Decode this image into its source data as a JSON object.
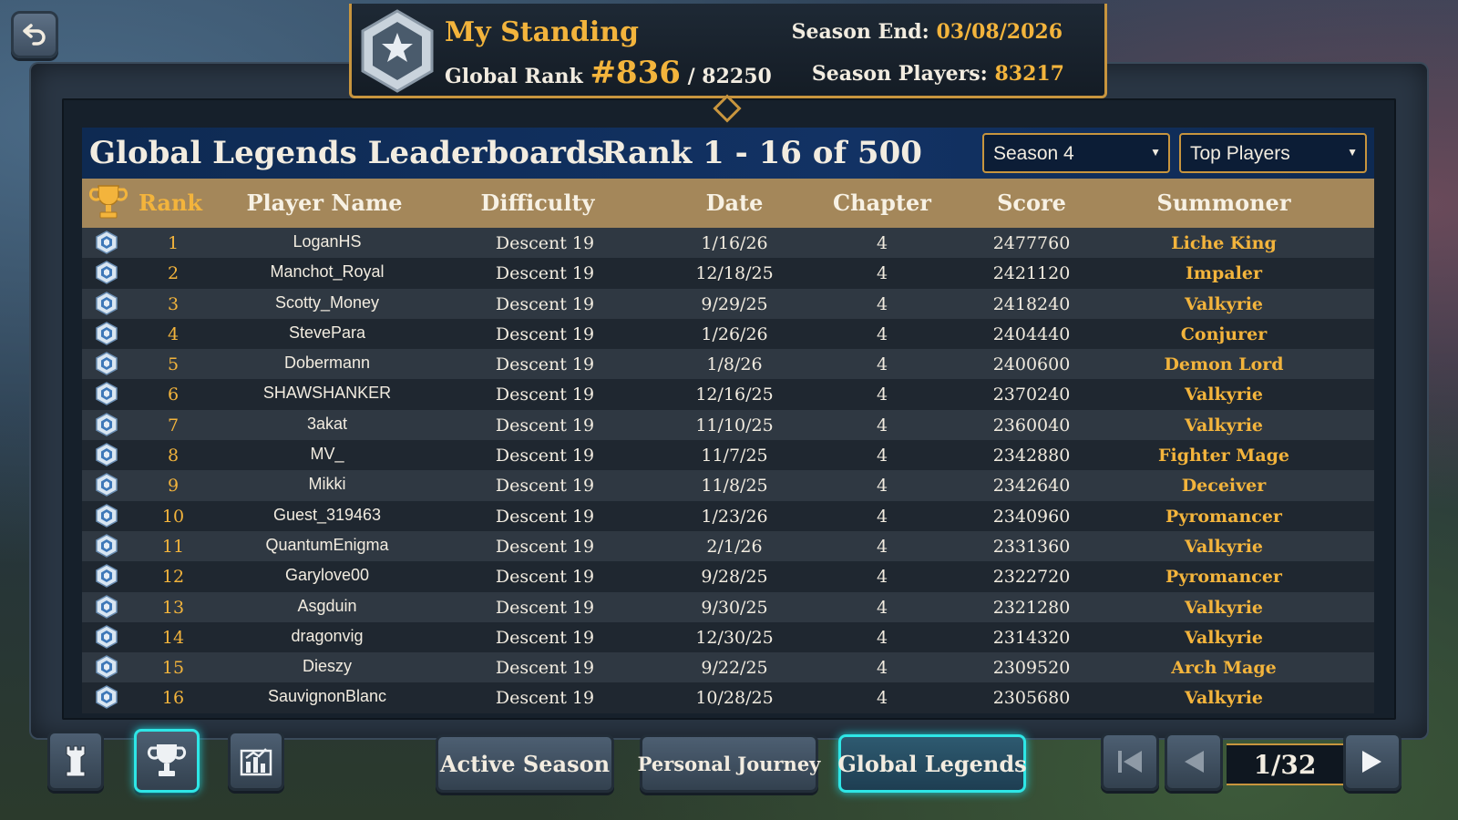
{
  "standing": {
    "title": "My Standing",
    "rank_label": "Global Rank",
    "rank": "#836",
    "rank_total": "/ 82250",
    "season_end_label": "Season End:",
    "season_end": "03/08/2026",
    "season_players_label": "Season Players:",
    "season_players": "83217"
  },
  "board": {
    "title": "Global Legends Leaderboards",
    "range": "Rank 1 - 16 of 500",
    "season_select": "Season 4",
    "filter_select": "Top Players"
  },
  "columns": {
    "rank": "Rank",
    "name": "Player Name",
    "difficulty": "Difficulty",
    "date": "Date",
    "chapter": "Chapter",
    "score": "Score",
    "summoner": "Summoner"
  },
  "rows": [
    {
      "rank": "1",
      "name": "LoganHS",
      "difficulty": "Descent 19",
      "date": "1/16/26",
      "chapter": "4",
      "score": "2477760",
      "summoner": "Liche King"
    },
    {
      "rank": "2",
      "name": "Manchot_Royal",
      "difficulty": "Descent 19",
      "date": "12/18/25",
      "chapter": "4",
      "score": "2421120",
      "summoner": "Impaler"
    },
    {
      "rank": "3",
      "name": "Scotty_Money",
      "difficulty": "Descent 19",
      "date": "9/29/25",
      "chapter": "4",
      "score": "2418240",
      "summoner": "Valkyrie"
    },
    {
      "rank": "4",
      "name": "StevePara",
      "difficulty": "Descent 19",
      "date": "1/26/26",
      "chapter": "4",
      "score": "2404440",
      "summoner": "Conjurer"
    },
    {
      "rank": "5",
      "name": "Dobermann",
      "difficulty": "Descent 19",
      "date": "1/8/26",
      "chapter": "4",
      "score": "2400600",
      "summoner": "Demon Lord"
    },
    {
      "rank": "6",
      "name": "SHAWSHANKER",
      "difficulty": "Descent 19",
      "date": "12/16/25",
      "chapter": "4",
      "score": "2370240",
      "summoner": "Valkyrie"
    },
    {
      "rank": "7",
      "name": "3akat",
      "difficulty": "Descent 19",
      "date": "11/10/25",
      "chapter": "4",
      "score": "2360040",
      "summoner": "Valkyrie"
    },
    {
      "rank": "8",
      "name": "MV_",
      "difficulty": "Descent 19",
      "date": "11/7/25",
      "chapter": "4",
      "score": "2342880",
      "summoner": "Fighter Mage"
    },
    {
      "rank": "9",
      "name": "Mikki",
      "difficulty": "Descent 19",
      "date": "11/8/25",
      "chapter": "4",
      "score": "2342640",
      "summoner": "Deceiver"
    },
    {
      "rank": "10",
      "name": "Guest_319463",
      "difficulty": "Descent 19",
      "date": "1/23/26",
      "chapter": "4",
      "score": "2340960",
      "summoner": "Pyromancer"
    },
    {
      "rank": "11",
      "name": "QuantumEnigma",
      "difficulty": "Descent 19",
      "date": "2/1/26",
      "chapter": "4",
      "score": "2331360",
      "summoner": "Valkyrie"
    },
    {
      "rank": "12",
      "name": "Garylove00",
      "difficulty": "Descent 19",
      "date": "9/28/25",
      "chapter": "4",
      "score": "2322720",
      "summoner": "Pyromancer"
    },
    {
      "rank": "13",
      "name": "Asgduin",
      "difficulty": "Descent 19",
      "date": "9/30/25",
      "chapter": "4",
      "score": "2321280",
      "summoner": "Valkyrie"
    },
    {
      "rank": "14",
      "name": "dragonvig",
      "difficulty": "Descent 19",
      "date": "12/30/25",
      "chapter": "4",
      "score": "2314320",
      "summoner": "Valkyrie"
    },
    {
      "rank": "15",
      "name": "Dieszy",
      "difficulty": "Descent 19",
      "date": "9/22/25",
      "chapter": "4",
      "score": "2309520",
      "summoner": "Arch Mage"
    },
    {
      "rank": "16",
      "name": "SauvignonBlanc",
      "difficulty": "Descent 19",
      "date": "10/28/25",
      "chapter": "4",
      "score": "2305680",
      "summoner": "Valkyrie"
    }
  ],
  "tabs": {
    "active_season": "Active Season",
    "personal_journey": "Personal Journey",
    "global_legends": "Global Legends"
  },
  "pagination": {
    "page": "1/32"
  },
  "icons": {
    "back": "back-arrow-icon",
    "emblem": "star-hexagon-icon",
    "row_badge": "hexagon-badge-icon",
    "tower": "tower-icon",
    "trophy": "trophy-icon",
    "stats": "stats-icon",
    "first": "first-page-icon",
    "prev": "prev-page-icon",
    "next": "next-page-icon"
  },
  "colors": {
    "accent_gold": "#f3b43c",
    "active_cyan": "#2ee6e6",
    "title_bar": "#123264",
    "header_tan": "#a4875a"
  }
}
